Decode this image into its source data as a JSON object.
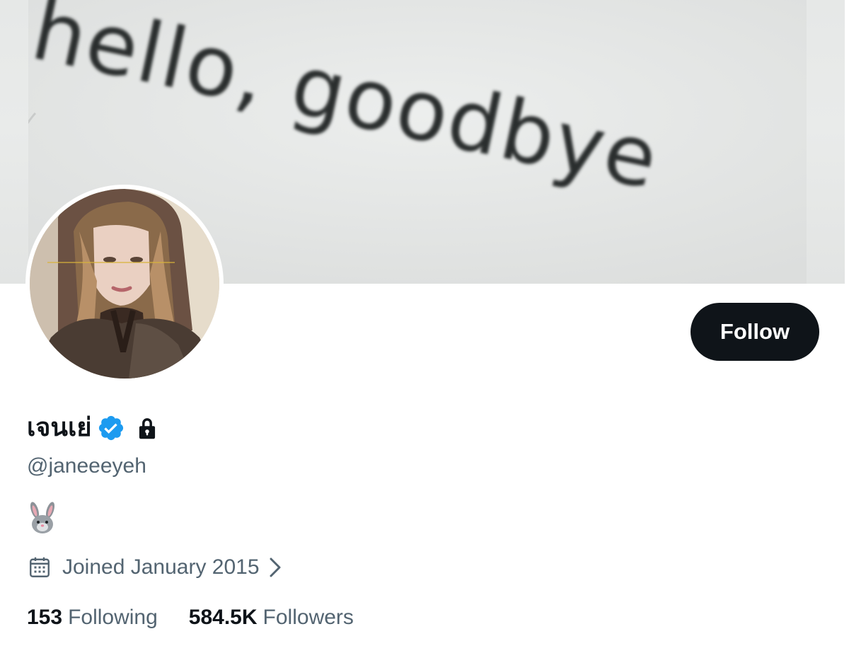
{
  "banner": {
    "text": "hello, goodbye"
  },
  "profile": {
    "display_name": "เจนเย่",
    "handle": "@janeeeyeh",
    "verified_icon": "verified-badge-icon",
    "locked_icon": "lock-icon",
    "bio_emoji": "rabbit-face",
    "joined": "Joined January 2015"
  },
  "actions": {
    "follow_label": "Follow"
  },
  "stats": {
    "following_count": "153",
    "following_label": "Following",
    "followers_count": "584.5K",
    "followers_label": "Followers"
  },
  "colors": {
    "primary_text": "#0f1419",
    "secondary_text": "#536471",
    "verified_blue": "#1d9bf0",
    "button_bg": "#0f1419"
  }
}
